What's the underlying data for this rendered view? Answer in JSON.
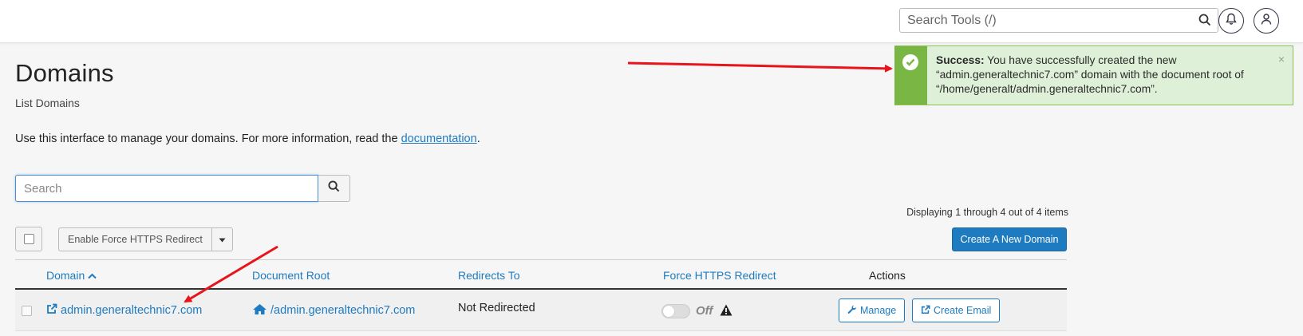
{
  "header": {
    "tool_search_placeholder": "Search Tools (/)",
    "search_icon": "search-icon",
    "notifications_icon": "bell-icon",
    "user_icon": "user-icon"
  },
  "page": {
    "title": "Domains",
    "subtitle": "List Domains",
    "intro_text": "Use this interface to manage your domains. For more information, read the ",
    "intro_link": "documentation",
    "intro_end": "."
  },
  "search": {
    "placeholder": "Search"
  },
  "toolbar": {
    "displaying": "Displaying 1 through 4 out of 4 items",
    "bulk_action": "Enable Force HTTPS Redirect",
    "create_button": "Create A New Domain"
  },
  "table": {
    "headers": {
      "domain": "Domain",
      "document_root": "Document Root",
      "redirects_to": "Redirects To",
      "force_https": "Force HTTPS Redirect",
      "actions": "Actions"
    },
    "rows": [
      {
        "domain": "admin.generaltechnic7.com",
        "document_root": "/admin.generaltechnic7.com",
        "redirects_to": "Not Redirected",
        "force_https": "Off",
        "manage": "Manage",
        "create_email": "Create Email"
      }
    ]
  },
  "alert": {
    "label": "Success:",
    "message": " You have successfully created the new “admin.generaltechnic7.com” domain with the document root of “/home/generalt/admin.generaltechnic7.com”.",
    "close": "×"
  },
  "colors": {
    "accent": "#1e7bc0",
    "success_strip": "#79b644",
    "success_bg": "#dff0d8",
    "annotation_arrow": "#e8141b"
  }
}
